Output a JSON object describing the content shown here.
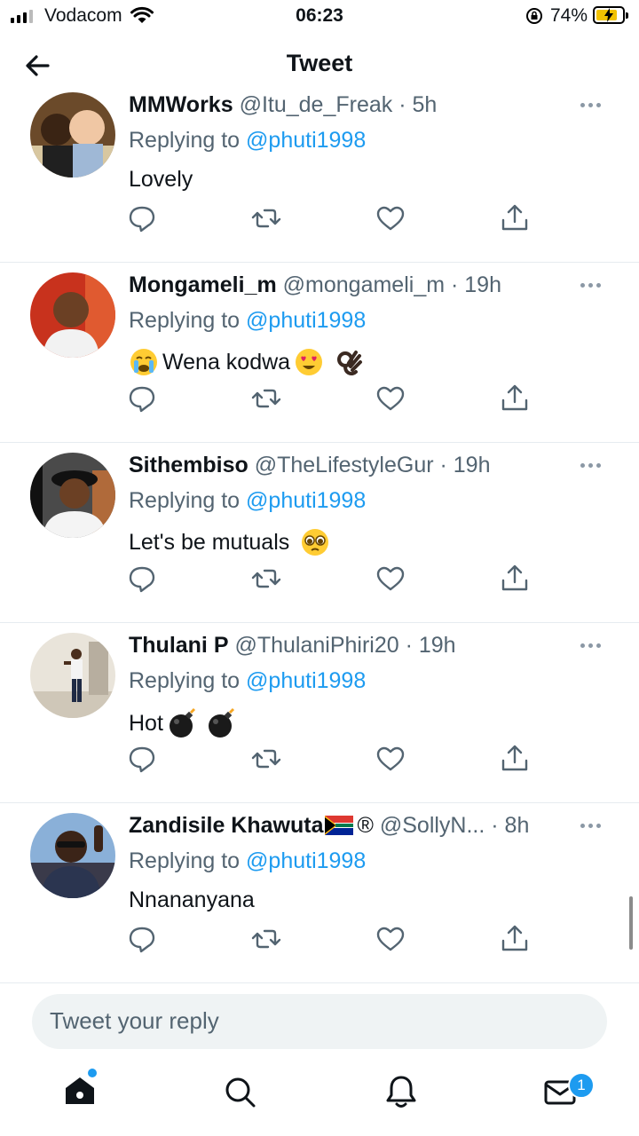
{
  "status_bar": {
    "carrier": "Vodacom",
    "time": "06:23",
    "battery": "74%"
  },
  "header": {
    "title": "Tweet"
  },
  "tweets": [
    {
      "name": "MMWorks",
      "handle": "@Itu_de_Freak",
      "time": "5h",
      "replying_prefix": "Replying to",
      "replying_to": "@phuti1998",
      "text": "Lovely",
      "emoji": []
    },
    {
      "name": "Mongameli_m",
      "handle": "@mongameli_m",
      "time": "19h",
      "replying_prefix": "Replying to",
      "replying_to": "@phuti1998",
      "text": "Wena kodwa",
      "emoji": [
        "crying-face",
        "heart-eyes",
        "ok-hand"
      ]
    },
    {
      "name": "Sithembiso",
      "handle": "@TheLifestyleGur",
      "time": "19h",
      "replying_prefix": "Replying to",
      "replying_to": "@phuti1998",
      "text": "Let's be mutuals",
      "emoji": [
        "pleading-face"
      ]
    },
    {
      "name": "Thulani P",
      "handle": "@ThulaniPhiri20",
      "time": "19h",
      "replying_prefix": "Replying to",
      "replying_to": "@phuti1998",
      "text": "Hot",
      "emoji": [
        "bomb",
        "bomb"
      ]
    },
    {
      "name": "Zandisile Khawuta",
      "name_suffix": "®",
      "handle": "@SollyN...",
      "time": "8h",
      "replying_prefix": "Replying to",
      "replying_to": "@phuti1998",
      "text": "Nnananyana",
      "emoji": [
        "south-africa-flag"
      ]
    }
  ],
  "reply_box": {
    "placeholder": "Tweet your reply"
  },
  "tab_bar": {
    "messages_badge": "1"
  },
  "colors": {
    "accent": "#1d9bf0",
    "secondary_text": "#536471",
    "divider": "#e6ecf0"
  }
}
